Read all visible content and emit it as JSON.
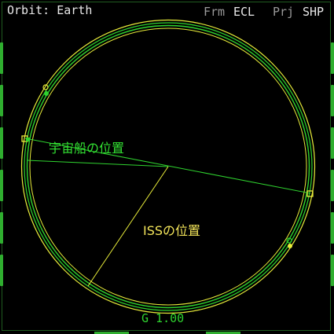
{
  "header": {
    "title": "Orbit: Earth",
    "frame_label": "Frm",
    "frame_value": "ECL",
    "projection_label": "Prj",
    "projection_value": "SHP"
  },
  "footer": {
    "scale_text": "G 1.00"
  },
  "annotations": {
    "spacecraft_position": "宇宙船の位置",
    "iss_position": "ISSの位置"
  },
  "colors": {
    "background": "#000000",
    "spacecraft_orbit": "#2fd32f",
    "target_orbit": "#e8ec3a",
    "text_primary": "#e9e9e9",
    "text_dim": "#9a9a9a"
  }
}
